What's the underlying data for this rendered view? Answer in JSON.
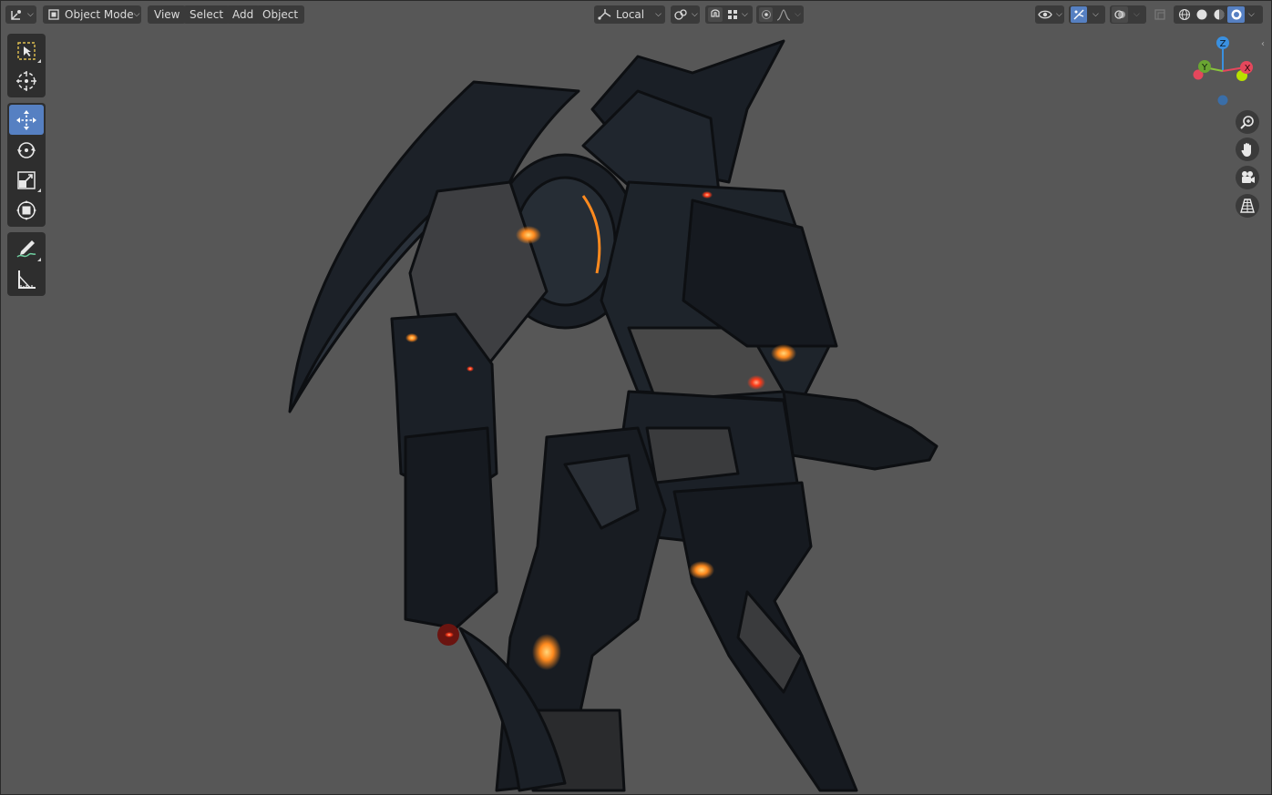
{
  "header": {
    "mode_label": "Object Mode",
    "menus": [
      "View",
      "Select",
      "Add",
      "Object"
    ],
    "transform_orientation": "Local"
  },
  "icons": {
    "editor_type": "editor-type-icon",
    "mode": "object-mode-icon",
    "orientation": "transform-orientation-icon",
    "pivot": "pivot-point-icon",
    "snap": "snap-icon",
    "snap_target": "snap-increment-icon",
    "proportional": "proportional-editing-icon",
    "falloff": "falloff-curve-icon",
    "visibility": "object-visibility-icon",
    "gizmo": "gizmo-toggle-icon",
    "overlays": "overlays-icon",
    "xray": "xray-icon",
    "shading_wire": "wireframe-shading-icon",
    "shading_solid": "solid-shading-icon",
    "shading_material": "material-preview-icon",
    "shading_render": "rendered-shading-icon"
  },
  "tools": [
    "select-box",
    "cursor",
    "move",
    "rotate",
    "scale",
    "transform",
    "annotate",
    "measure"
  ],
  "active_tool": "move",
  "gizmo_axes": {
    "z": "Z",
    "y": "Y",
    "x": "X"
  },
  "colors": {
    "viewport_bg": "#575757",
    "header_btn": "#3a3a3a",
    "accent": "#5680c2",
    "axis_x": "#e5475c",
    "axis_y": "#8ac53c",
    "axis_z": "#3a90e0",
    "glow": "#ff8a1e"
  }
}
